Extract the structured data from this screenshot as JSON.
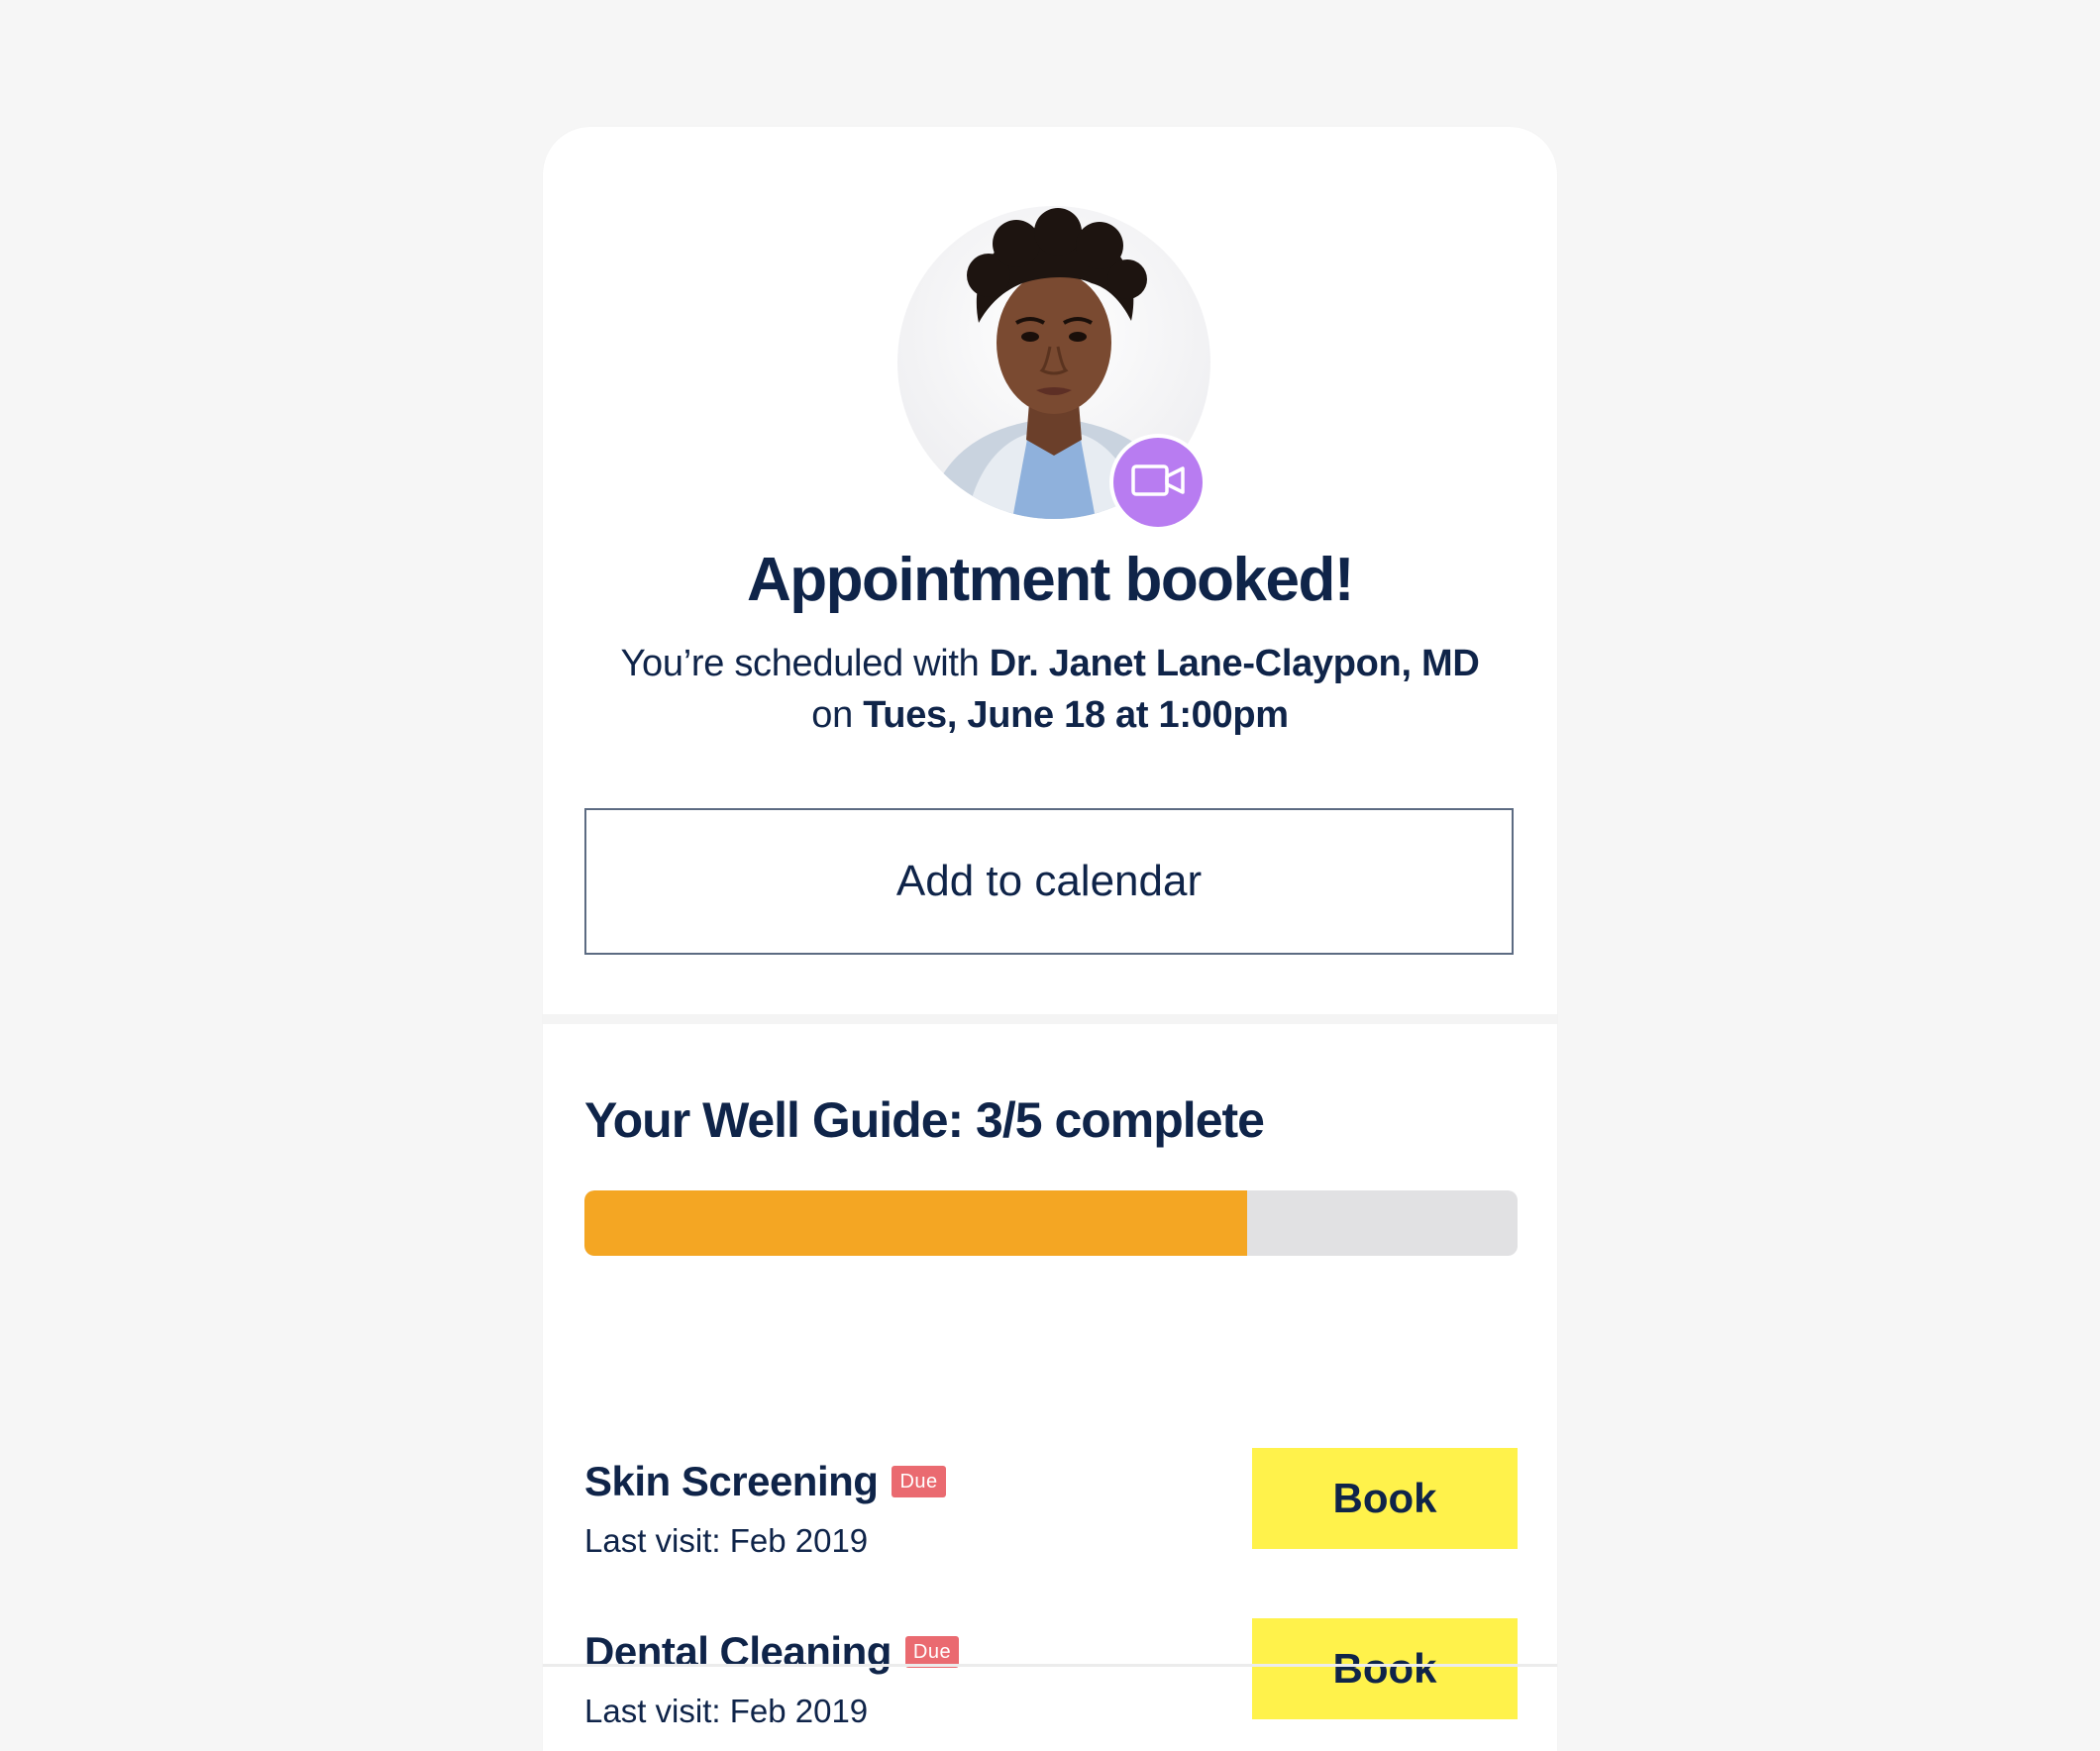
{
  "confirmation": {
    "title": "Appointment booked!",
    "subtitle_prefix": "You’re scheduled with ",
    "doctor_name": "Dr. Janet Lane-Claypon, MD",
    "subtitle_mid": "on ",
    "date_time": "Tues, June 18 at 1:00pm",
    "add_calendar_label": "Add to calendar",
    "video_badge_icon": "video-camera-icon"
  },
  "well_guide": {
    "title": "Your Well Guide: 3/5 complete",
    "progress_fraction": 0.71,
    "progress_color": "#f4a623",
    "tasks": [
      {
        "name": "Skin Screening",
        "badge": "Due",
        "last_visit": "Last visit: Feb 2019",
        "button_label": "Book"
      },
      {
        "name": "Dental Cleaning",
        "badge": "Due",
        "last_visit": "Last visit: Feb 2019",
        "button_label": "Book"
      }
    ]
  },
  "colors": {
    "text": "#0f2449",
    "accent_purple": "#b87cf1",
    "badge_red": "#ea6a70",
    "book_yellow": "#fff24b"
  }
}
